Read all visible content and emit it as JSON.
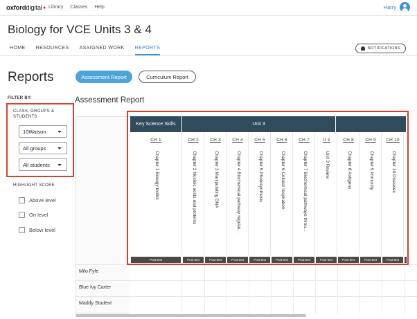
{
  "header": {
    "logo_main": "oxford",
    "logo_sub": "digital",
    "logo_mark": "✦",
    "nav": [
      "Library",
      "Classes",
      "Help"
    ],
    "user_name": "Harry"
  },
  "course_title": "Biology for VCE Units 3 & 4",
  "tabs": [
    "HOME",
    "RESOURCES",
    "ASSIGNED WORK",
    "REPORTS"
  ],
  "active_tab": "REPORTS",
  "notifications_label": "NOTIFICATIONS",
  "page_title": "Reports",
  "report_buttons": {
    "assessment": "Assessment Report",
    "curriculum": "Curriculum Report"
  },
  "filters": {
    "filter_by_label": "FILTER BY:",
    "group_label": "CLASS, GROUPS & STUDENTS",
    "class_select": "10Watson",
    "groups_select": "All groups",
    "students_select": "All students"
  },
  "highlight": {
    "label": "HIGHLIGHT SCORE",
    "options": [
      "Above level",
      "On level",
      "Below level"
    ]
  },
  "section_title": "Assessment Report",
  "table": {
    "group_headers": {
      "key_science": "Key Science Skills",
      "unit": "Unit 3"
    },
    "columns": [
      {
        "code": "CH 1",
        "name": "Chapter 1 Biology toolkit",
        "test": "Post-test"
      },
      {
        "code": "CH 2",
        "name": "Chapter 2 Nucleic acids and proteins",
        "test": "Post-test"
      },
      {
        "code": "CH 3",
        "name": "Chapter 3 Manipulating DNA",
        "test": "Post-test"
      },
      {
        "code": "CH 4",
        "name": "Chapter 4 Biochemical pathway regulat...",
        "test": "Post-test"
      },
      {
        "code": "CH 5",
        "name": "Chapter 5 Photosynthesis",
        "test": "Post-test"
      },
      {
        "code": "CH 6",
        "name": "Chapter 6 Cellular respiration",
        "test": "Post-test"
      },
      {
        "code": "CH 7",
        "name": "Chapter 7 Biochemical pathways throu...",
        "test": "Post-test"
      },
      {
        "code": "U 3",
        "name": "Unit 3 Review",
        "test": "Post-test"
      },
      {
        "code": "CH 8",
        "name": "Chapter 8 Antigens",
        "test": "Post-test"
      },
      {
        "code": "CH 9",
        "name": "Chapter 9 Immunity",
        "test": "Post-test"
      },
      {
        "code": "CH 10",
        "name": "Chapter 10 Diseases",
        "test": "Post-test"
      }
    ],
    "students": [
      "Milo Fyfe",
      "Blue Ivy Carter",
      "Maddy Student"
    ]
  }
}
